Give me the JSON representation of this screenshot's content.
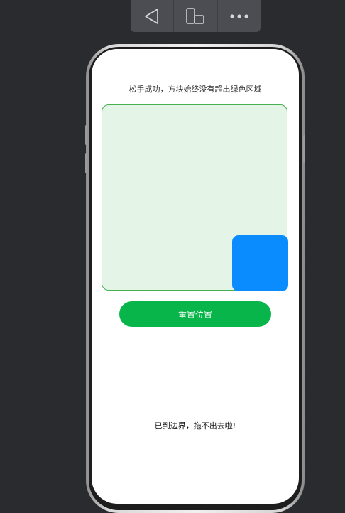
{
  "toolbar": {
    "buttons": [
      {
        "icon": "back-triangle-icon"
      },
      {
        "icon": "device-rotate-icon"
      },
      {
        "icon": "more-dots-icon"
      }
    ]
  },
  "screen": {
    "status_text": "松手成功，方块始终没有超出绿色区域",
    "drag_area": {
      "background_color": "#e4f4e6",
      "border_color": "#46b04e"
    },
    "block": {
      "color": "#0a8cff"
    },
    "reset_button": {
      "label": "重置位置",
      "color": "#07b54a"
    },
    "boundary_text": "已到边界，拖不出去啦!"
  }
}
